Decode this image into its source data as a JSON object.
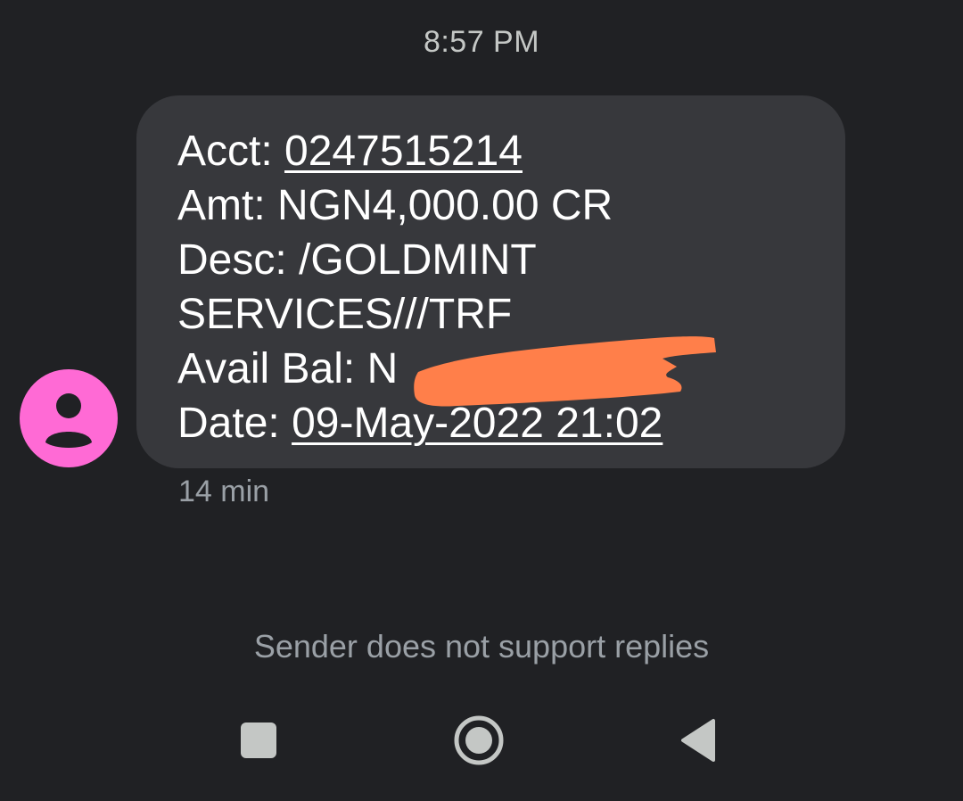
{
  "header": {
    "timestamp": "8:57 PM"
  },
  "message": {
    "lines": [
      {
        "label": "Acct: ",
        "value": "0247515214"
      },
      {
        "label": "Amt: ",
        "value": "NGN4,000.00 CR"
      },
      {
        "label": "Desc: ",
        "value": "/GOLDMINT"
      },
      {
        "label": "",
        "value": "SERVICES///TRF"
      },
      {
        "label": "Avail Bal: ",
        "value": "N"
      },
      {
        "label": "Date: ",
        "value": "09-May-2022 21:02"
      }
    ],
    "time_ago": "14 min"
  },
  "footer": {
    "notice": "Sender does not support replies"
  },
  "navbar": {
    "recents_icon": "square-recents-icon",
    "home_icon": "circle-home-icon",
    "back_icon": "triangle-back-icon"
  },
  "colors": {
    "background": "#202124",
    "bubble": "#37383c",
    "avatar": "#ff6ad5",
    "redaction": "#ff7f4a",
    "secondary_text": "#9aa0a6"
  }
}
